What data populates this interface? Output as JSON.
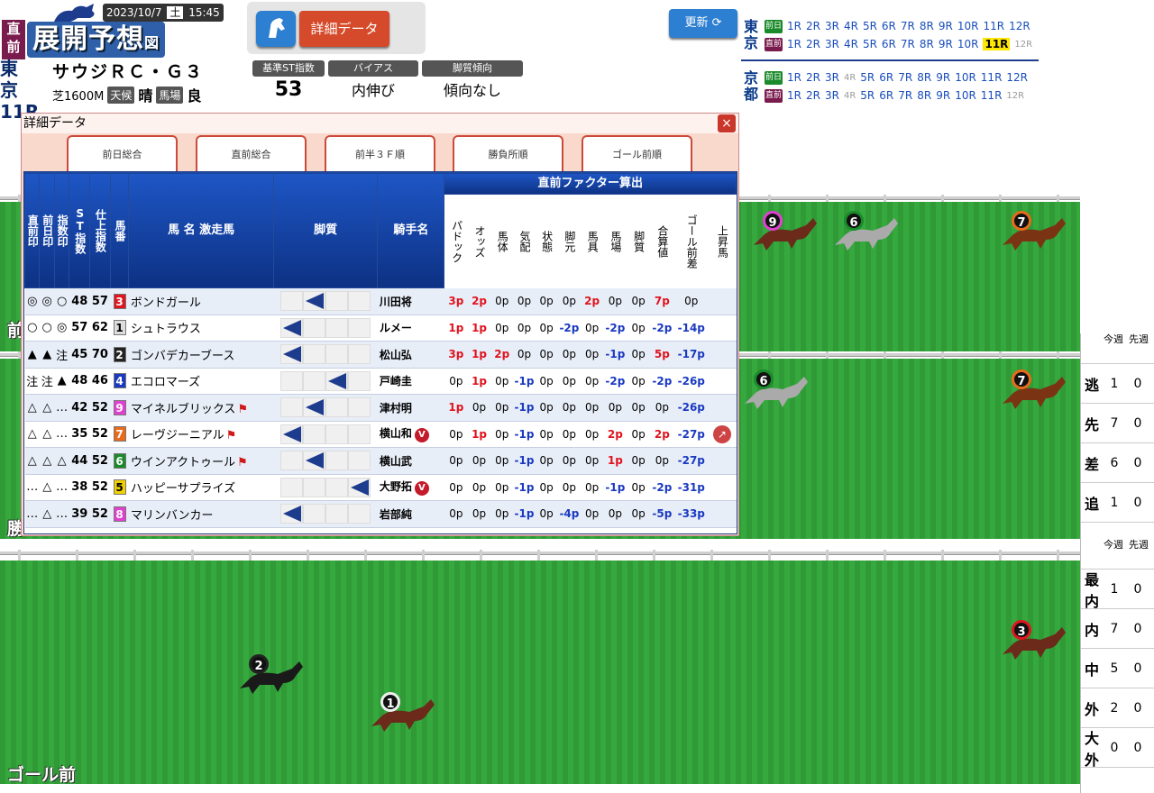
{
  "header": {
    "logo_tag": "直前",
    "logo_text": "展開予想",
    "logo_suffix": "図",
    "date": "2023/10/7",
    "weekday": "土",
    "time": "15:45",
    "place": "東京",
    "race_no": "11R",
    "race_name": "サウジＲＣ・Ｇ３",
    "course": "芝1600M",
    "weather_label": "天候",
    "weather": "晴",
    "going_label": "馬場",
    "going": "良",
    "detail_button": "詳細データ",
    "st_label": "基準ST指数",
    "st_value": "53",
    "bias_label": "バイアス",
    "bias_value": "内伸び",
    "style_label": "脚質傾向",
    "style_value": "傾向なし",
    "update_button": "更新"
  },
  "race_nav": {
    "tracks": [
      {
        "name": "東京",
        "rows": [
          {
            "kind": "前日",
            "races": [
              "1R",
              "2R",
              "3R",
              "4R",
              "5R",
              "6R",
              "7R",
              "8R",
              "9R",
              "10R",
              "11R",
              "12R"
            ]
          },
          {
            "kind": "直前",
            "races": [
              "1R",
              "2R",
              "3R",
              "4R",
              "5R",
              "6R",
              "7R",
              "8R",
              "9R",
              "10R",
              "11R",
              "12R"
            ],
            "current": "11R"
          }
        ]
      },
      {
        "name": "京都",
        "rows": [
          {
            "kind": "前日",
            "races": [
              "1R",
              "2R",
              "3R",
              "4R",
              "5R",
              "6R",
              "7R",
              "8R",
              "9R",
              "10R",
              "11R",
              "12R"
            ]
          },
          {
            "kind": "直前",
            "races": [
              "1R",
              "2R",
              "3R",
              "4R",
              "5R",
              "6R",
              "7R",
              "8R",
              "9R",
              "10R",
              "11R",
              "12R"
            ]
          }
        ]
      }
    ]
  },
  "tracks": {
    "label1": "前",
    "label2": "勝",
    "label3": "ゴール前"
  },
  "side_panel": {
    "header": [
      "今週",
      "先週"
    ],
    "styles": [
      {
        "label": "逃",
        "this": "1",
        "last": "0"
      },
      {
        "label": "先",
        "this": "7",
        "last": "0"
      },
      {
        "label": "差",
        "this": "6",
        "last": "0"
      },
      {
        "label": "追",
        "this": "1",
        "last": "0"
      }
    ],
    "lanes": [
      {
        "label": "最内",
        "this": "1",
        "last": "0"
      },
      {
        "label": "内",
        "this": "7",
        "last": "0"
      },
      {
        "label": "中",
        "this": "5",
        "last": "0"
      },
      {
        "label": "外",
        "this": "2",
        "last": "0"
      },
      {
        "label": "大外",
        "this": "0",
        "last": "0"
      }
    ]
  },
  "modal": {
    "title": "詳細データ",
    "close": "×",
    "tabs": [
      "前日総合",
      "直前総合",
      "前半３Ｆ順",
      "勝負所順",
      "ゴール前順"
    ],
    "table_group_header": "直前ファクター算出",
    "col_headers": {
      "c1": "直前印",
      "c2": "前日印",
      "c3": "指数印",
      "c4": "ST指数",
      "c5": "仕上指数",
      "c6": "馬番",
      "c7": "馬 名 激走馬",
      "c8": "脚質",
      "c9": "騎手名",
      "f": [
        "パドック",
        "オッズ",
        "馬体",
        "気配",
        "状態",
        "脚元",
        "馬具",
        "馬場",
        "脚質",
        "合算値",
        "ゴール前差",
        "上昇馬"
      ]
    },
    "rows": [
      {
        "m1": "◎",
        "m2": "◎",
        "m3": "○",
        "st": "48",
        "sh": "57",
        "no": "3",
        "color": "#e0141e",
        "name": "ボンドガール",
        "jockey": "川田将",
        "f": [
          "3p",
          "2p",
          "0p",
          "0p",
          "0p",
          "0p",
          "2p",
          "0p",
          "0p",
          "7p",
          "0p"
        ]
      },
      {
        "m1": "○",
        "m2": "○",
        "m3": "◎",
        "st": "57",
        "sh": "62",
        "no": "1",
        "color": "#ddd",
        "name": "シュトラウス",
        "jockey": "ルメー",
        "f": [
          "1p",
          "1p",
          "0p",
          "0p",
          "0p",
          "-2p",
          "0p",
          "-2p",
          "0p",
          "-2p",
          "-14p"
        ]
      },
      {
        "m1": "▲",
        "m2": "▲",
        "m3": "注",
        "st": "45",
        "sh": "70",
        "no": "2",
        "color": "#222",
        "name": "ゴンバデカーブース",
        "jockey": "松山弘",
        "f": [
          "3p",
          "1p",
          "2p",
          "0p",
          "0p",
          "0p",
          "0p",
          "-1p",
          "0p",
          "5p",
          "-17p"
        ]
      },
      {
        "m1": "注",
        "m2": "注",
        "m3": "▲",
        "st": "48",
        "sh": "46",
        "no": "4",
        "color": "#1a3ac0",
        "name": "エコロマーズ",
        "jockey": "戸崎圭",
        "f": [
          "0p",
          "1p",
          "0p",
          "-1p",
          "0p",
          "0p",
          "0p",
          "-2p",
          "0p",
          "-2p",
          "-26p"
        ]
      },
      {
        "m1": "△",
        "m2": "△",
        "m3": "…",
        "st": "42",
        "sh": "52",
        "no": "9",
        "color": "#e040d0",
        "name": "マイネルブリックス",
        "jockey": "津村明",
        "f": [
          "1p",
          "0p",
          "0p",
          "-1p",
          "0p",
          "0p",
          "0p",
          "0p",
          "0p",
          "0p",
          "-26p"
        ]
      },
      {
        "m1": "△",
        "m2": "△",
        "m3": "…",
        "st": "35",
        "sh": "52",
        "no": "7",
        "color": "#e86a1a",
        "name": "レーヴジーニアル",
        "jockey": "横山和",
        "f": [
          "0p",
          "1p",
          "0p",
          "-1p",
          "0p",
          "0p",
          "0p",
          "2p",
          "0p",
          "2p",
          "-27p"
        ]
      },
      {
        "m1": "△",
        "m2": "△",
        "m3": "△",
        "st": "44",
        "sh": "52",
        "no": "6",
        "color": "#1a8a2a",
        "name": "ウインアクトゥール",
        "jockey": "横山武",
        "f": [
          "0p",
          "0p",
          "0p",
          "-1p",
          "0p",
          "0p",
          "0p",
          "1p",
          "0p",
          "0p",
          "-27p"
        ]
      },
      {
        "m1": "…",
        "m2": "△",
        "m3": "…",
        "st": "38",
        "sh": "52",
        "no": "5",
        "color": "#f0d000",
        "name": "ハッピーサプライズ",
        "jockey": "大野拓",
        "f": [
          "0p",
          "0p",
          "0p",
          "-1p",
          "0p",
          "0p",
          "0p",
          "-1p",
          "0p",
          "-2p",
          "-31p"
        ]
      },
      {
        "m1": "…",
        "m2": "△",
        "m3": "…",
        "st": "39",
        "sh": "52",
        "no": "8",
        "color": "#e040d0",
        "name": "マリンバンカー",
        "jockey": "岩部純",
        "f": [
          "0p",
          "0p",
          "0p",
          "-1p",
          "0p",
          "-4p",
          "0p",
          "0p",
          "0p",
          "-5p",
          "-33p"
        ]
      }
    ]
  },
  "horse_markers": {
    "t1": [
      "9",
      "6",
      "7"
    ],
    "t2": [
      "6",
      "7"
    ],
    "t3": [
      "2",
      "1",
      "3"
    ]
  }
}
